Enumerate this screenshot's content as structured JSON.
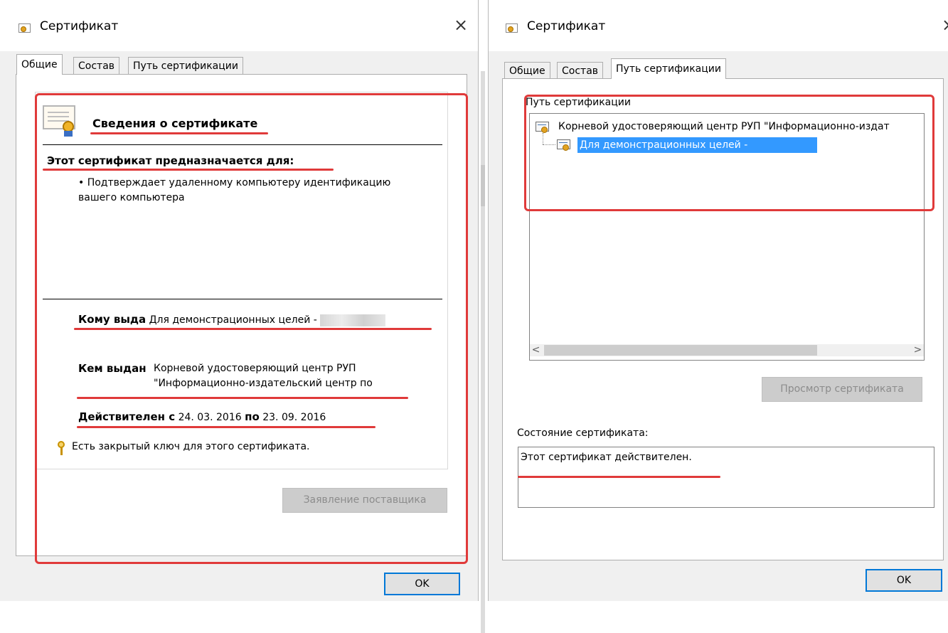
{
  "left_dialog": {
    "title": "Сертификат",
    "close_glyph": "×",
    "tabs": [
      "Общие",
      "Состав",
      "Путь сертификации"
    ],
    "info_heading": "Сведения о сертификате",
    "purpose_heading": "Этот сертификат предназначается для:",
    "purpose_line1": "• Подтверждает удаленному компьютеру идентификацию",
    "purpose_line2": "вашего компьютера",
    "issued_to_label": "Кому выда",
    "issued_to_value": "Для демонстрационных целей -",
    "issued_by_label": "Кем выдан",
    "issued_by_line1": "Корневой удостоверяющий центр РУП",
    "issued_by_line2": "\"Информационно-издательский центр по",
    "valid_from_label": "Действителен с",
    "valid_from_value": "24. 03. 2016",
    "valid_to_label": "по",
    "valid_to_value": "23. 09. 2016",
    "private_key_text": "Есть закрытый ключ для этого сертификата.",
    "issuer_statement_button": "Заявление поставщика",
    "ok_button": "OK"
  },
  "right_dialog": {
    "title": "Сертификат",
    "close_glyph": "×",
    "tabs": [
      "Общие",
      "Состав",
      "Путь сертификации"
    ],
    "path_group_label": "Путь сертификации",
    "tree_root": "Корневой удостоверяющий центр РУП \"Информационно-издат",
    "tree_child": "Для демонстрационных целей -",
    "scroll_left": "<",
    "scroll_right": ">",
    "view_cert_button": "Просмотр сертификата",
    "status_label": "Состояние сертификата:",
    "status_text": "Этот сертификат действителен.",
    "ok_button": "OK"
  },
  "colors": {
    "highlight": "#e03a3a",
    "selection": "#3399ff",
    "focus_border": "#0078d7"
  }
}
